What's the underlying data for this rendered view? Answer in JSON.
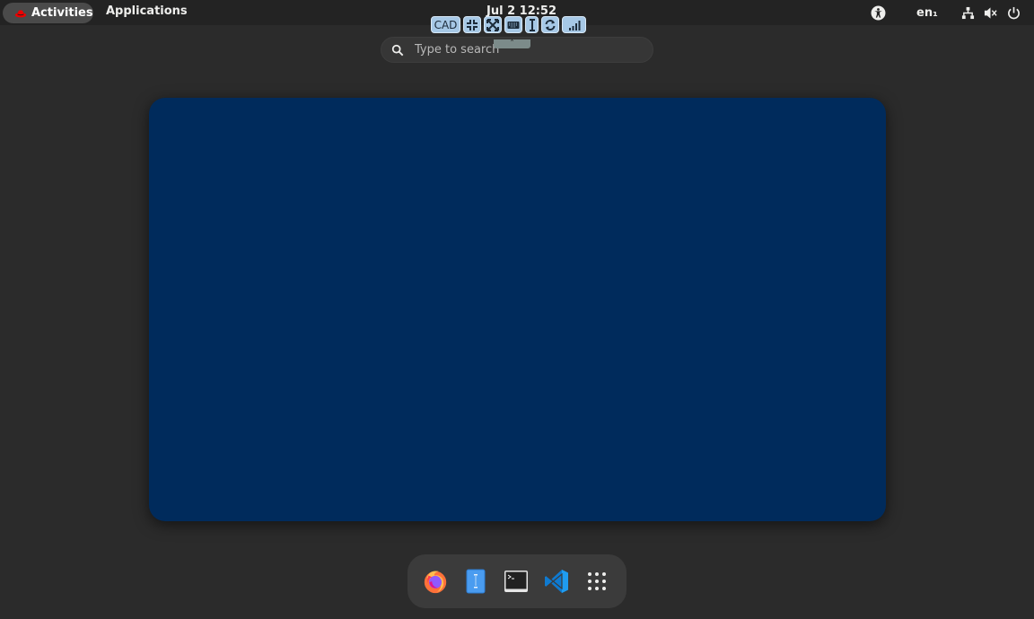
{
  "topbar": {
    "activities_label": "Activities",
    "applications_label": "Applications",
    "clock": "Jul 2  12:52",
    "language": "en₁"
  },
  "remote_toolbar": {
    "cad_label": "CAD",
    "buttons": [
      "cad",
      "fullscreen-exit-icon",
      "fullscreen-icon",
      "keyboard-icon",
      "text-cursor-icon",
      "refresh-icon",
      "signal-icon"
    ]
  },
  "search": {
    "placeholder": "Type to search",
    "collapse_glyph": "˄"
  },
  "tray_icons": [
    "accessibility-icon",
    "network-icon",
    "volume-icon",
    "power-icon"
  ],
  "dash": {
    "apps": [
      "firefox",
      "files",
      "terminal",
      "vscode",
      "show-applications"
    ]
  },
  "colors": {
    "workspace": "#002b5c",
    "toolbar_button": "#a6c8e6",
    "background": "#2b2b2b"
  }
}
